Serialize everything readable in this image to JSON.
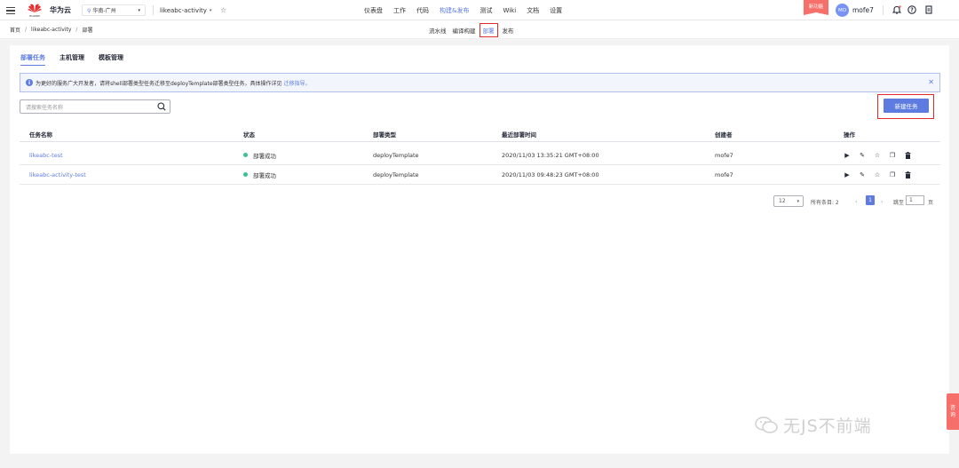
{
  "header": {
    "brand": "华为云",
    "logo_small": "HUAWEI",
    "region": "华南-广州",
    "project": "likeabc-activity",
    "nav": [
      "仪表盘",
      "工作",
      "代码",
      "构建&发布",
      "测试",
      "Wiki",
      "文档",
      "设置"
    ],
    "nav_active_index": 3,
    "new_feature_badge": "新功能",
    "avatar_initials": "MO",
    "username": "mofe7"
  },
  "breadcrumb": [
    "首页",
    "likeabc-activity",
    "部署"
  ],
  "subnav": [
    "流水线",
    "编译构建",
    "部署",
    "发布"
  ],
  "subnav_active_index": 2,
  "tabs": [
    "部署任务",
    "主机管理",
    "模板管理"
  ],
  "notice": {
    "text": "为更好的服务广大开发者，请将shell部署类型任务迁移至deployTemplate部署类型任务，具体操作详见",
    "link": "迁移指导。"
  },
  "search": {
    "placeholder": "请搜索任务名称"
  },
  "create_button": "新建任务",
  "table": {
    "headers": [
      "任务名称",
      "状态",
      "部署类型",
      "最近部署时间",
      "创建者",
      "操作"
    ],
    "rows": [
      {
        "name": "likeabc-test",
        "status": "部署成功",
        "type": "deployTemplate",
        "time": "2020/11/03 13:35:21 GMT+08:00",
        "creator": "mofe7"
      },
      {
        "name": "likeabc-activity-test",
        "status": "部署成功",
        "type": "deployTemplate",
        "time": "2020/11/03 09:48:23 GMT+08:00",
        "creator": "mofe7"
      }
    ],
    "op_icons": [
      "play-icon",
      "edit-icon",
      "star-icon",
      "copy-icon",
      "delete-icon"
    ]
  },
  "pagination": {
    "page_size": "12",
    "total_label": "所有条目: 2",
    "current_page": "1",
    "goto_label": "跳至",
    "goto_value": "1",
    "page_unit": "页"
  },
  "side_tab": [
    "咨",
    "询"
  ],
  "watermark": "无JS不前端",
  "colors": {
    "accent": "#5e7ce0",
    "success": "#3ac295",
    "highlight_red": "#e02b2b",
    "badge": "#f66f6a"
  }
}
